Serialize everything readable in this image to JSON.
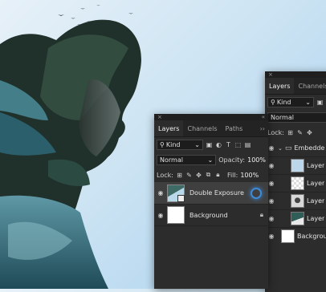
{
  "colors": {
    "panel_bg": "#2c2c2c",
    "accent": "#3d8bd9"
  },
  "front_panel": {
    "close_glyph": "×",
    "collapse_glyph": "«",
    "tabs": [
      "Layers",
      "Channels",
      "Paths"
    ],
    "more_glyph": "››",
    "filter_kind": "Kind",
    "blend_mode": "Normal",
    "opacity_label": "Opacity:",
    "opacity_value": "100%",
    "lock_label": "Lock:",
    "fill_label": "Fill:",
    "fill_value": "100%",
    "layers": [
      {
        "name": "Double Exposure",
        "selected": true
      },
      {
        "name": "Background",
        "selected": false
      }
    ]
  },
  "back_panel": {
    "close_glyph": "×",
    "tabs": [
      "Layers",
      "Channels"
    ],
    "filter_kind": "Kind",
    "blend_mode": "Normal",
    "lock_label": "Lock:",
    "group_name": "Embedde",
    "layers": [
      {
        "name": "Layer"
      },
      {
        "name": "Layer"
      },
      {
        "name": "Layer"
      },
      {
        "name": "Layer"
      },
      {
        "name": "Backgrou"
      }
    ]
  }
}
